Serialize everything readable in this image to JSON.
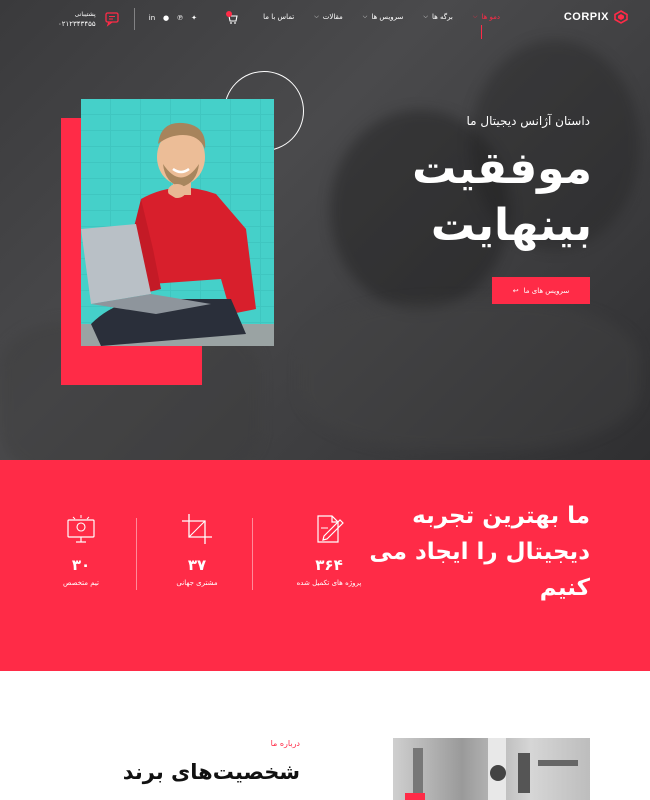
{
  "brand": {
    "name": "CORPIX",
    "accent": "#ff2b47"
  },
  "nav": {
    "items": [
      {
        "label": "دمو ها",
        "dropdown": true,
        "active": true
      },
      {
        "label": "برگه ها",
        "dropdown": true
      },
      {
        "label": "سرویس ها",
        "dropdown": true
      },
      {
        "label": "مقالات",
        "dropdown": true
      },
      {
        "label": "تماس با ما",
        "dropdown": false
      }
    ],
    "support_label": "پشتیبانی",
    "support_phone": "۰۲۱۲۳۴۳۴۵۵"
  },
  "hero": {
    "subtitle": "داستان آژانس دیجیتال ما",
    "title_line1": "موفقیت",
    "title_line2": "بینهایت",
    "button_label": "سرویس های ما",
    "button_icon": "arrow-left"
  },
  "stats": {
    "title": "ما بهترین تجربه دیجیتال را ایجاد می کنیم",
    "items": [
      {
        "number": "۳۶۴",
        "label": "پروژه های تکمیل شده",
        "icon": "document-edit-icon"
      },
      {
        "number": "۳۷",
        "label": "مشتری جهانی",
        "icon": "crop-icon"
      },
      {
        "number": "۳۰",
        "label": "تیم متخصص",
        "icon": "monitor-bulb-icon"
      }
    ]
  },
  "about": {
    "label": "درباره ما",
    "title": "شخصیت‌های برند"
  }
}
